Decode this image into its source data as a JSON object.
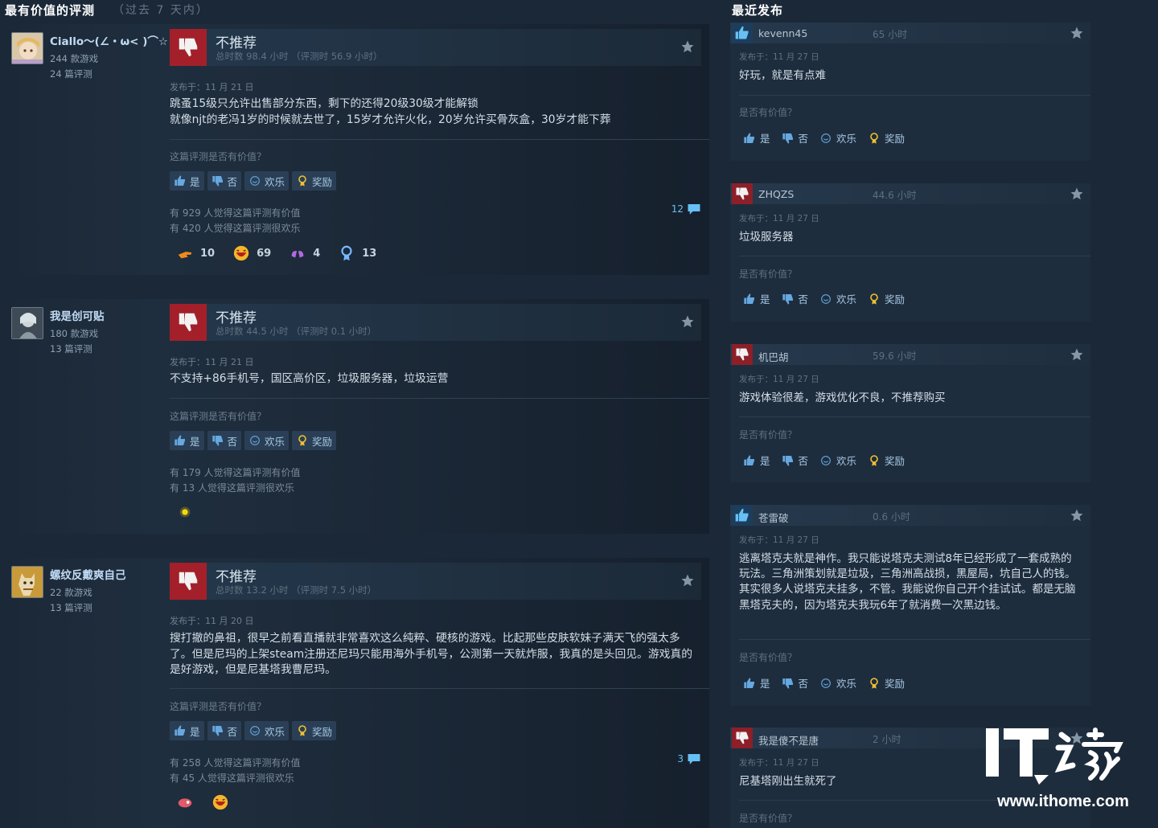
{
  "header_left": {
    "title": "最有价值的评测",
    "subtitle": "（过去 7 天内）"
  },
  "header_right": {
    "title": "最近发布"
  },
  "vote_labels": {
    "yes": "是",
    "no": "否",
    "funny": "欢乐",
    "award": "奖励"
  },
  "reviews": [
    {
      "author": "Ciallo～(∠・ω< )⌒☆",
      "games": "244 款游戏",
      "reviews_count": "24 篇评测",
      "verdict": "不推荐",
      "hours": "总时数 98.4 小时 （评测时 56.9 小时）",
      "posted": "发布于：11 月 21 日",
      "content": "跳蚤15级只允许出售部分东西，剩下的还得20级30级才能解锁\n就像njt的老冯1岁的时候就去世了，15岁才允许火化，20岁允许买骨灰盒，30岁才能下葬",
      "question": "这篇评测是否有价值？",
      "helpful": "有 929 人觉得这篇评测有价值",
      "funny": "有 420 人觉得这篇评测很欢乐",
      "comments": "12",
      "awards": [
        {
          "icon": "hand-point-icon",
          "count": "10"
        },
        {
          "icon": "laughing-face-icon",
          "count": "69"
        },
        {
          "icon": "clapping-hands-icon",
          "count": "4"
        },
        {
          "icon": "medal-icon",
          "count": "13"
        }
      ]
    },
    {
      "author": "我是创可贴",
      "games": "180 款游戏",
      "reviews_count": "13 篇评测",
      "verdict": "不推荐",
      "hours": "总时数 44.5 小时 （评测时 0.1 小时）",
      "posted": "发布于：11 月 21 日",
      "content": "不支持+86手机号，国区高价区，垃圾服务器，垃圾运营",
      "question": "这篇评测是否有价值？",
      "helpful": "有 179 人觉得这篇评测有价值",
      "funny": "有 13 人觉得这篇评测很欢乐",
      "awards": [
        {
          "icon": "sparkle-icon"
        }
      ]
    },
    {
      "author": "螺纹反戴爽自己",
      "games": "22 款游戏",
      "reviews_count": "13 篇评测",
      "verdict": "不推荐",
      "hours": "总时数 13.2 小时 （评测时 7.5 小时）",
      "posted": "发布于：11 月 20 日",
      "content": "搜打撤的鼻祖，很早之前看直播就非常喜欢这么纯粹、硬核的游戏。比起那些皮肤软妹子满天飞的强太多了。但是尼玛的上架steam注册还尼玛只能用海外手机号，公测第一天就炸服，我真的是头回见。游戏真的是好游戏，但是尼基塔我曹尼玛。",
      "question": "这篇评测是否有价值？",
      "helpful": "有 258 人觉得这篇评测有价值",
      "funny": "有 45 人觉得这篇评测很欢乐",
      "comments": "3",
      "awards": [
        {
          "icon": "pill-face-icon"
        },
        {
          "icon": "laughing-face-icon"
        }
      ]
    }
  ],
  "posts": [
    {
      "name": "kevenn45",
      "hours": "65 小时",
      "recommend": "up",
      "posted": "发布于：11 月 27 日",
      "text": "好玩，就是有点难",
      "question": "是否有价值？"
    },
    {
      "name": "ZHQZS",
      "hours": "44.6 小时",
      "recommend": "down",
      "posted": "发布于：11 月 27 日",
      "text": "垃圾服务器",
      "question": "是否有价值？"
    },
    {
      "name": "机巴胡",
      "hours": "59.6 小时",
      "recommend": "down",
      "posted": "发布于：11 月 27 日",
      "text": "游戏体验很差，游戏优化不良，不推荐购买",
      "question": "是否有价值？"
    },
    {
      "name": "苍雷破",
      "hours": "0.6 小时",
      "recommend": "up",
      "posted": "发布于：11 月 27 日",
      "text": "逃离塔克夫就是神作。我只能说塔克夫测试8年已经形成了一套成熟的玩法。三角洲策划就是垃圾，三角洲高战损，黑屋局，坑自己人的钱。其实很多人说塔克夫挂多，不管。我能说你自己开个挂试试。都是无脑黑塔克夫的，因为塔克夫我玩6年了就消费一次黑边钱。",
      "question": "是否有价值？"
    },
    {
      "name": "我是傻不是唐",
      "hours": "2 小时",
      "recommend": "down",
      "posted": "发布于：11 月 27 日",
      "text": "尼基塔刚出生就死了",
      "question": "是否有价值？"
    }
  ],
  "watermark": {
    "logo": "IT之家",
    "url": "www.ithome.com"
  },
  "colors": {
    "background": "#1b2838",
    "thumb_down": "#a3202a",
    "thumb_up": "#66c0f4",
    "link": "#66c0f4"
  }
}
